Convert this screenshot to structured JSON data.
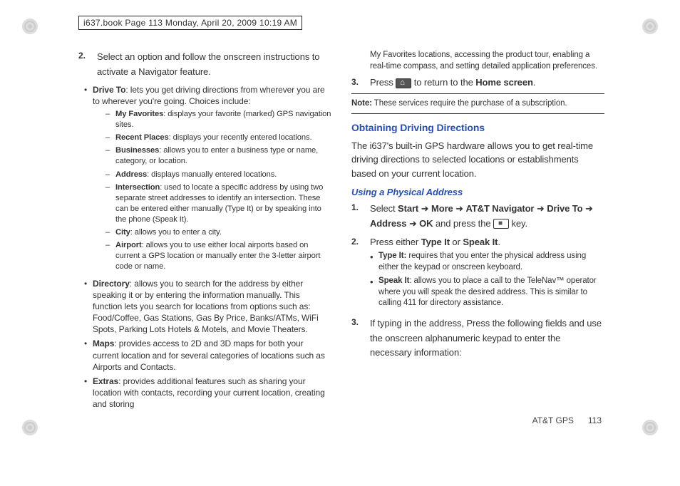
{
  "crop": "i637.book  Page 113  Monday, April 20, 2009  10:19 AM",
  "left": {
    "step2": {
      "num": "2.",
      "text": "Select an option and follow the onscreen instructions to activate a Navigator feature."
    },
    "bullets": [
      {
        "bold": "Drive To",
        "text": ": lets you get driving directions from wherever you are to wherever you're going. Choices include:",
        "sub": [
          {
            "bold": "My Favorites",
            "text": ": displays your favorite (marked) GPS navigation sites."
          },
          {
            "bold": "Recent Places",
            "text": ": displays your recently entered locations."
          },
          {
            "bold": "Businesses",
            "text": ": allows you to enter a business type or name, category, or location."
          },
          {
            "bold": "Address",
            "text": ": displays manually entered locations."
          },
          {
            "bold": "Intersection",
            "text": ": used to locate a specific address by using two separate street addresses to identify an intersection. These can be entered either manually (Type It) or by speaking into the phone (Speak It)."
          },
          {
            "bold": "City",
            "text": ": allows you to enter a city."
          },
          {
            "bold": "Airport",
            "text": ": allows you to use either local airports based on current a GPS location or manually enter the 3-letter airport code or name."
          }
        ]
      },
      {
        "bold": "Directory",
        "text": ": allows you to search for the address by either speaking it or by entering the information manually. This function lets you search for locations from options such as: Food/Coffee, Gas Stations, Gas By Price, Banks/ATMs, WiFi Spots, Parking Lots Hotels & Motels, and Movie Theaters."
      },
      {
        "bold": "Maps",
        "text": ": provides access to 2D and 3D maps for both your current location and for several categories of locations such as Airports and Contacts."
      },
      {
        "bold": "Extras",
        "text": ": provides additional features such as sharing your location with contacts, recording your current location, creating and storing"
      }
    ]
  },
  "right": {
    "cont": "My Favorites locations, accessing the product tour, enabling a real-time compass, and setting detailed application preferences.",
    "step3": {
      "num": "3.",
      "pre": "Press ",
      "post": " to return to the ",
      "bold": "Home screen",
      "end": "."
    },
    "noteLabel": "Note:",
    "noteText": " These services require the purchase of a subscription.",
    "h2": "Obtaining Driving Directions",
    "intro": "The i637's built-in GPS hardware allows you to get real-time driving directions to selected locations or establishments based on your current location.",
    "h3": "Using a Physical Address",
    "s1": {
      "num": "1.",
      "pre": "Select ",
      "path": [
        "Start",
        "More",
        "AT&T Navigator",
        "Drive To",
        "Address",
        "OK"
      ],
      "mid": " and press the ",
      "post": " key."
    },
    "s2": {
      "num": "2.",
      "pre": "Press either ",
      "b1": "Type It",
      "or": " or ",
      "b2": "Speak It",
      "end": "."
    },
    "s2bullets": [
      {
        "bold": "Type It:",
        "text": " requires that you enter the physical address using either the keypad or onscreen keyboard."
      },
      {
        "bold": "Speak It",
        "text": ": allows you to place a call to the TeleNav™ operator where you will speak the desired address. This is similar to calling 411 for directory assistance."
      }
    ],
    "s3": {
      "num": "3.",
      "text": "If typing in the address, Press the following fields and use the onscreen alphanumeric keypad to enter the necessary information:"
    }
  },
  "footer": {
    "section": "AT&T GPS",
    "page": "113"
  }
}
